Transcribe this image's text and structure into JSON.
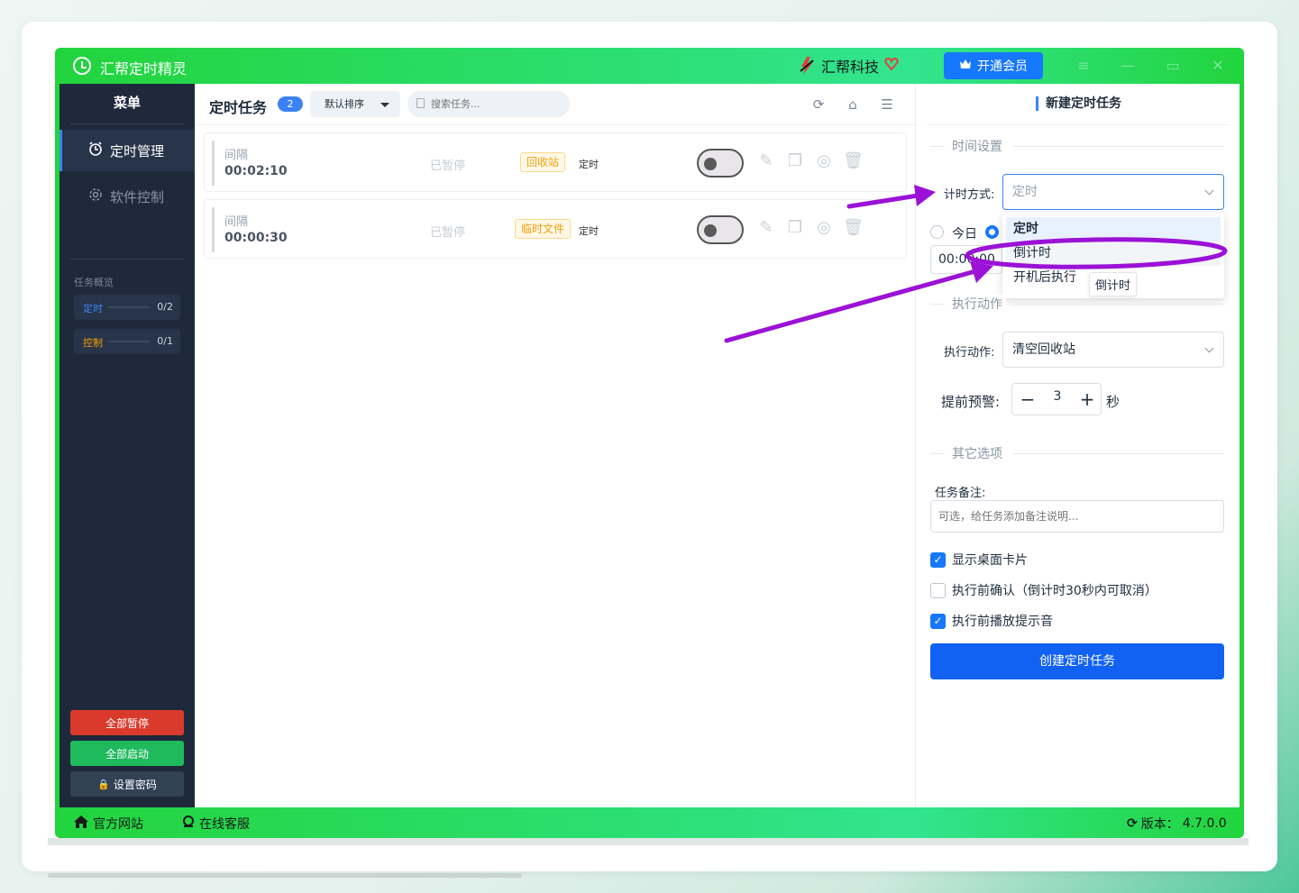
{
  "window": {
    "title": "汇帮定时精灵",
    "brand": "汇帮科技",
    "vip_button": "开通会员"
  },
  "sidebar": {
    "title": "菜单",
    "items": [
      {
        "label": "定时管理",
        "active": true
      },
      {
        "label": "软件控制",
        "active": false
      }
    ],
    "overview_title": "任务概览",
    "stats": [
      {
        "label": "定时",
        "value": "0/2",
        "color": "#3b82f6"
      },
      {
        "label": "控制",
        "value": "0/1",
        "color": "#f59e0b"
      }
    ],
    "buttons": {
      "pause_all": "全部暂停",
      "start_all": "全部启动",
      "set_password": "设置密码"
    }
  },
  "main": {
    "title": "定时任务",
    "count": "2",
    "sort": "默认排序",
    "search_placeholder": "搜索任务...",
    "tasks": [
      {
        "type": "间隔",
        "time": "00:02:10",
        "status": "已暂停",
        "tag": "回收站",
        "mode": "定时",
        "enabled": false
      },
      {
        "type": "间隔",
        "time": "00:00:30",
        "status": "已暂停",
        "tag": "临时文件",
        "mode": "定时",
        "enabled": false
      }
    ]
  },
  "panel": {
    "title": "新建定时任务",
    "time_section": "时间设置",
    "timing_label": "计时方式:",
    "timing_value": "定时",
    "dropdown_options": [
      "定时",
      "倒计时",
      "开机后执行"
    ],
    "radio_today": "今日",
    "time_value": "00:00:00",
    "tooltip": "倒计时",
    "action_section": "执行动作",
    "action_label": "执行动作:",
    "action_value": "清空回收站",
    "warn_label": "提前预警:",
    "warn_value": "3",
    "warn_unit": "秒",
    "other_section": "其它选项",
    "note_label": "任务备注:",
    "note_placeholder": "可选，给任务添加备注说明...",
    "checkboxes": [
      {
        "label": "显示桌面卡片",
        "checked": true
      },
      {
        "label": "执行前确认（倒计时30秒内可取消）",
        "checked": false
      },
      {
        "label": "执行前播放提示音",
        "checked": true
      }
    ],
    "create_button": "创建定时任务"
  },
  "footer": {
    "website": "官方网站",
    "support": "在线客服",
    "version_label": "版本：",
    "version": "4.7.0.0"
  },
  "colors": {
    "accent": "#1677ff",
    "title_bar": "#22d43c",
    "sidebar": "#1e293b",
    "danger": "#d93a2b",
    "success": "#1fba5c",
    "annotation": "#9b12d6"
  }
}
